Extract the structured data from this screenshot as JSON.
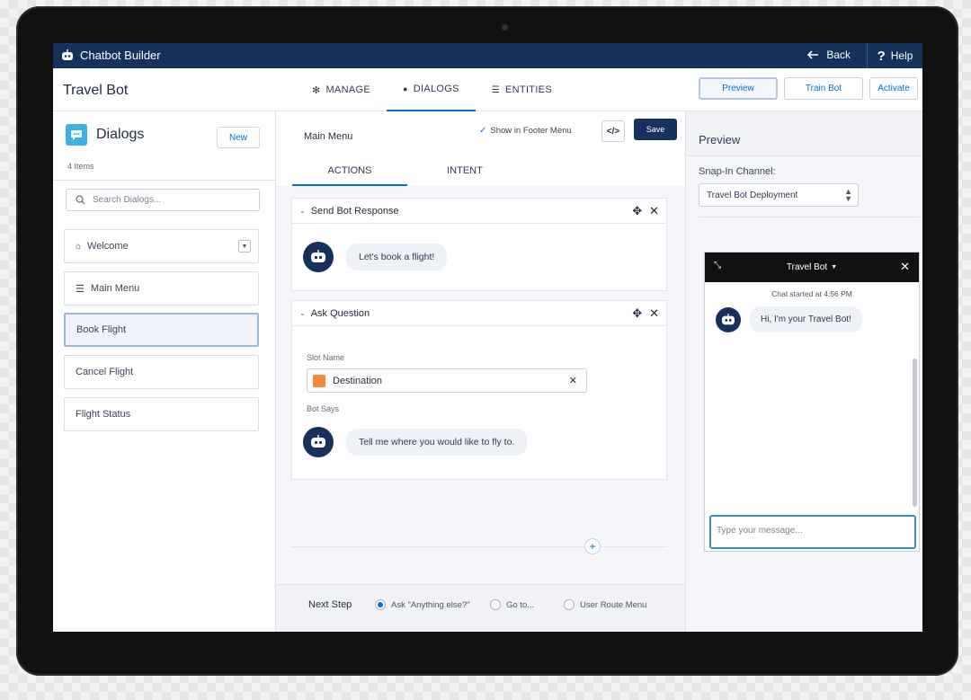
{
  "app": {
    "name": "Chatbot Builder",
    "back_label": "Back",
    "help_label": "Help"
  },
  "header": {
    "title": "Travel Bot",
    "tabs": [
      {
        "label": "MANAGE",
        "icon": "gear-icon"
      },
      {
        "label": "DIALOGS",
        "icon": "chat-icon"
      },
      {
        "label": "ENTITIES",
        "icon": "database-icon"
      }
    ],
    "buttons": {
      "preview": "Preview",
      "train": "Train Bot",
      "activate": "Activate"
    }
  },
  "sidebar": {
    "title": "Dialogs",
    "new_label": "New",
    "count": "4 Items",
    "search_placeholder": "Search Dialogs...",
    "items": [
      {
        "label": "Welcome",
        "icon": "home-icon"
      },
      {
        "label": "Main Menu",
        "icon": "list-icon"
      },
      {
        "label": "Book Flight"
      },
      {
        "label": "Cancel Flight"
      },
      {
        "label": "Flight Status"
      }
    ]
  },
  "editor": {
    "dialog_name": "Main Menu",
    "show_in_footer": "Show in Footer Menu",
    "code_label": "</>",
    "save_label": "Save",
    "tabs": [
      "ACTIONS",
      "INTENT"
    ],
    "send_response": {
      "title": "Send Bot Response",
      "message": "Let's book a flight!"
    },
    "ask_question": {
      "title": "Ask Question",
      "slot_label": "Slot Name",
      "slot_value": "Destination",
      "bot_says_label": "Bot Says",
      "bot_says": "Tell me where you would like to fly to."
    },
    "next_step": {
      "label": "Next Step",
      "options": [
        "Ask \"Anything else?\"",
        "Go to...",
        "User Route Menu"
      ]
    }
  },
  "preview": {
    "title": "Preview",
    "channel_label": "Snap-In Channel:",
    "channel_value": "Travel Bot Deployment",
    "chat": {
      "title": "Travel Bot",
      "started": "Chat started at 4:56 PM",
      "message": "Hi, I'm your Travel Bot!",
      "input_placeholder": "Type your message..."
    }
  },
  "colors": {
    "navy": "#16325c",
    "accent": "#0070d2",
    "dialog_icon": "#3eb2e0",
    "slot_icon": "#f38b3c"
  }
}
